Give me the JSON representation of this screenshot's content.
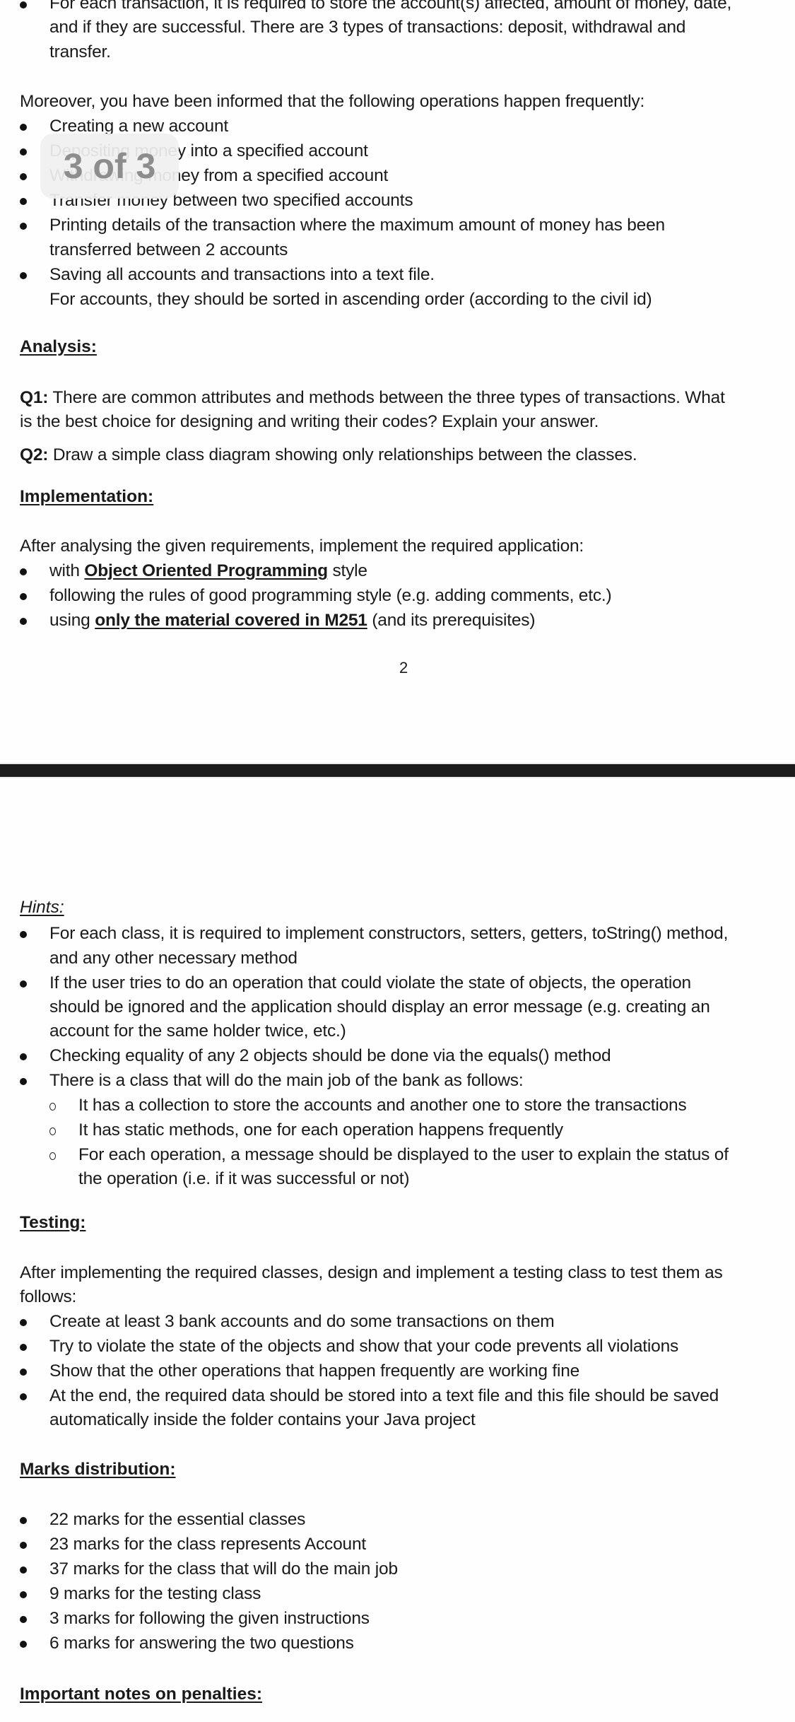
{
  "page_indicator": {
    "current": 3,
    "total": 3,
    "label": "3 of 3"
  },
  "page1": {
    "transaction_bullet": {
      "line1": "For each transaction, it is required to store the account(s) affected, amount of money, date,",
      "line2": "and if they are successful. There are 3 types of transactions: deposit, withdrawal and",
      "line3": "transfer."
    },
    "operations_intro": "Moreover, you have been informed that the following operations happen frequently:",
    "operations": [
      {
        "text": "Creating a new account"
      },
      {
        "text": "Depositing money into a specified account",
        "visible_text": "into a specified account"
      },
      {
        "text": "Withdrawing money from a specified account",
        "visible_text": "ney from a specified account"
      },
      {
        "text": "Transfer money between two specified accounts"
      },
      {
        "line1": "Printing details of the transaction where the maximum amount of money has been",
        "line2": "transferred between 2 accounts"
      },
      {
        "line1": "Saving all accounts and transactions into a text file.",
        "line2": "For accounts, they should be sorted in ascending order (according to the civil id)"
      }
    ],
    "analysis": {
      "heading": "Analysis:",
      "q1_label": "Q1:",
      "q1_line1": " There are common attributes and methods between the three types of transactions. What",
      "q1_line2": "is the best choice for designing and writing their codes? Explain your answer.",
      "q2_label": "Q2:",
      "q2_text": " Draw a simple class diagram showing only relationships between the classes."
    },
    "implementation": {
      "heading": "Implementation:",
      "intro": "After analysing the given requirements, implement the required application:",
      "items": [
        {
          "pre": "with ",
          "emph": "Object Oriented Programming",
          "post": " style"
        },
        {
          "pre": "following the rules of good programming style (e.g. adding comments, etc.)",
          "emph": "",
          "post": ""
        },
        {
          "pre": "using ",
          "emph": "only the material covered in M251",
          "post": " (and its prerequisites)"
        }
      ]
    },
    "page_number": "2"
  },
  "page2": {
    "hints": {
      "heading": "Hints:",
      "items": [
        {
          "line1": "For each class, it is required to implement constructors, setters, getters, toString() method,",
          "line2": "and any other necessary method"
        },
        {
          "line1": "If the user tries to do an operation that could violate the state of objects, the operation",
          "line2": "should be ignored and the application should display an error message (e.g. creating an",
          "line3": "account for the same holder twice, etc.)"
        },
        {
          "line1": "Checking equality of any 2 objects should be done via the equals() method"
        },
        {
          "line1": "There is a class that will do the main job of the bank as follows:"
        }
      ],
      "sub_items": [
        {
          "line1": "It has a collection to store the accounts and another one to store the transactions"
        },
        {
          "line1": "It has static methods, one for each operation happens frequently"
        },
        {
          "line1": "For each operation, a message should be displayed to the user to explain the status of",
          "line2": "the operation (i.e. if it was successful or not)"
        }
      ]
    },
    "testing": {
      "heading": "Testing:",
      "intro_line1": "After implementing the required classes, design and implement a testing class to test them as",
      "intro_line2": "follows:",
      "items": [
        {
          "line1": "Create at least 3 bank accounts and do some transactions on them"
        },
        {
          "line1": "Try to violate the state of the objects and show that your code prevents all violations"
        },
        {
          "line1": "Show that the other operations that happen frequently are working fine"
        },
        {
          "line1": "At the end, the required data should be stored into a text file and this file should be saved",
          "line2": "automatically inside the folder contains your Java project"
        }
      ]
    },
    "marks": {
      "heading": "Marks distribution:",
      "items": [
        "22 marks for the essential classes",
        "23 marks for the class represents Account",
        "37 marks for the class that will do the main job",
        "9 marks for the testing class",
        "3 marks for following the given instructions",
        "6 marks for answering the two questions"
      ]
    },
    "penalties": {
      "heading": "Important notes on penalties:"
    }
  }
}
